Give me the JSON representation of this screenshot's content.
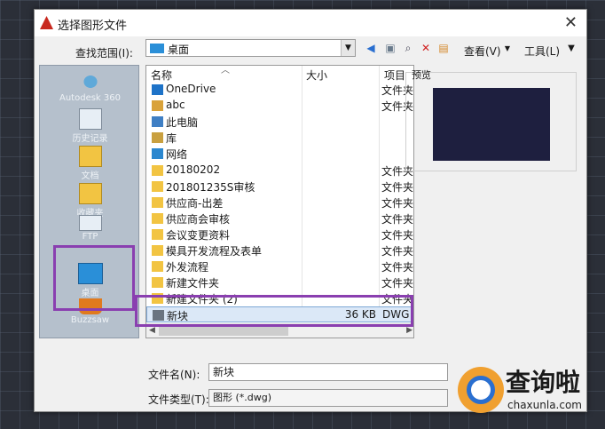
{
  "window": {
    "title": "选择图形文件",
    "close": "✕"
  },
  "toolbar": {
    "lookin_label": "查找范围(I):",
    "lookin_value": "桌面",
    "views_label": "查看(V)",
    "tools_label": "工具(L)"
  },
  "places": [
    {
      "label": "Autodesk 360",
      "icon": "cloud-icon"
    },
    {
      "label": "历史记录",
      "icon": "history-icon"
    },
    {
      "label": "文档",
      "icon": "documents-icon"
    },
    {
      "label": "收藏夹",
      "icon": "favorites-icon"
    },
    {
      "label": "FTP",
      "icon": "ftp-icon"
    },
    {
      "label": "桌面",
      "icon": "desktop-icon"
    },
    {
      "label": "Buzzsaw",
      "icon": "buzzsaw-icon"
    }
  ],
  "columns": {
    "name": "名称",
    "size": "大小",
    "type": "项目"
  },
  "files": [
    {
      "name": "OneDrive",
      "size": "",
      "type": "文件夹",
      "icon": "onedrive-icon"
    },
    {
      "name": "abc",
      "size": "",
      "type": "文件夹",
      "icon": "user-folder-icon"
    },
    {
      "name": "此电脑",
      "size": "",
      "type": "",
      "icon": "computer-icon"
    },
    {
      "name": "库",
      "size": "",
      "type": "",
      "icon": "library-icon"
    },
    {
      "name": "网络",
      "size": "",
      "type": "",
      "icon": "network-icon"
    },
    {
      "name": "20180202",
      "size": "",
      "type": "文件夹",
      "icon": "folder-icon"
    },
    {
      "name": "201801235S审核",
      "size": "",
      "type": "文件夹",
      "icon": "folder-icon"
    },
    {
      "name": "供应商-出差",
      "size": "",
      "type": "文件夹",
      "icon": "folder-icon"
    },
    {
      "name": "供应商会审核",
      "size": "",
      "type": "文件夹",
      "icon": "folder-icon"
    },
    {
      "name": "会议变更资料",
      "size": "",
      "type": "文件夹",
      "icon": "folder-icon"
    },
    {
      "name": "模具开发流程及表单",
      "size": "",
      "type": "文件夹",
      "icon": "folder-icon"
    },
    {
      "name": "外发流程",
      "size": "",
      "type": "文件夹",
      "icon": "folder-icon"
    },
    {
      "name": "新建文件夹",
      "size": "",
      "type": "文件夹",
      "icon": "folder-icon"
    },
    {
      "name": "新建文件夹 (2)",
      "size": "",
      "type": "文件夹",
      "icon": "folder-icon"
    },
    {
      "name": "新块",
      "size": "36 KB",
      "type": "DWG",
      "icon": "dwg-file-icon",
      "selected": true
    }
  ],
  "preview": {
    "label": "预览"
  },
  "form": {
    "filename_label": "文件名(N):",
    "filename_value": "新块",
    "filetype_label": "文件类型(T):",
    "filetype_value": "图形 (*.dwg)"
  },
  "watermark": {
    "cn": "查询啦",
    "en": "chaxunla.com"
  },
  "colors": {
    "highlight": "#8a3fb0",
    "places_bg": "#b5c0cc",
    "preview_bg": "#1e1f3f"
  }
}
